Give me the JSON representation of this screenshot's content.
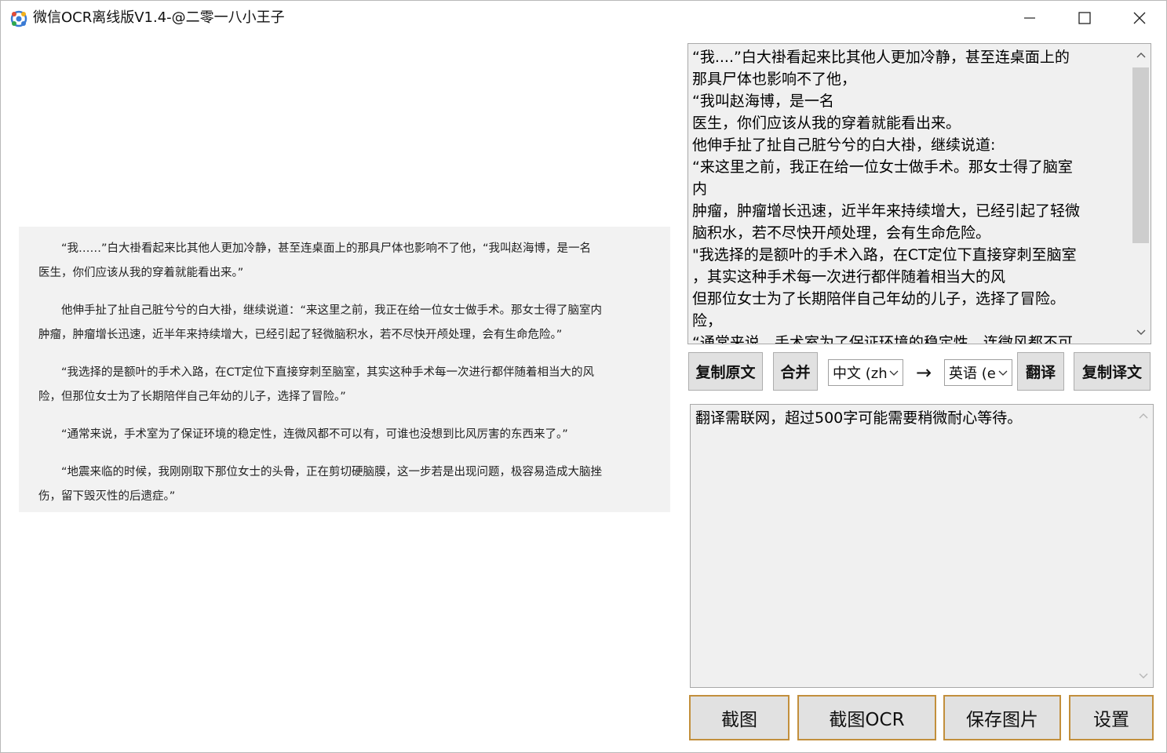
{
  "window": {
    "title": "微信OCR离线版V1.4-@二零一八小王子"
  },
  "capture": {
    "paragraphs": [
      {
        "lines": [
          "　　“我……”白大褂看起来比其他人更加冷静，甚至连桌面上的那具尸体也影响不了他，“我叫赵海博，是一名",
          "医生，你们应该从我的穿着就能看出来。”"
        ]
      },
      {
        "lines": [
          "　　他伸手扯了扯自己脏兮兮的白大褂，继续说道：“来这里之前，我正在给一位女士做手术。那女士得了脑室内",
          "肿瘤，肿瘤增长迅速，近半年来持续增大，已经引起了轻微脑积水，若不尽快开颅处理，会有生命危险。”"
        ]
      },
      {
        "lines": [
          "　　“我选择的是额叶的手术入路，在CT定位下直接穿刺至脑室，其实这种手术每一次进行都伴随着相当大的风",
          "险，但那位女士为了长期陪伴自己年幼的儿子，选择了冒险。”"
        ]
      },
      {
        "lines": [
          "　　“通常来说，手术室为了保证环境的稳定性，连微风都不可以有，可谁也没想到比风厉害的东西来了。”"
        ]
      },
      {
        "lines": [
          "　　“地震来临的时候，我刚刚取下那位女士的头骨，正在剪切硬脑膜，这一步若是出现问题，极容易造成大脑挫",
          "伤，留下毁灭性的后遗症。”"
        ]
      }
    ]
  },
  "source_text": {
    "lines": [
      " “我....”白大褂看起来比其他人更加冷静，甚至连桌面上的",
      "那具尸体也影响不了他，",
      " “我叫赵海博，是一名",
      "医生，你们应该从我的穿着就能看出来。",
      "他伸手扯了扯自己脏兮兮的白大褂，继续说道:",
      " “来这里之前，我正在给一位女士做手术。那女士得了脑室",
      "内",
      "肿瘤，肿瘤增长迅速，近半年来持续增大，已经引起了轻微",
      "脑积水，若不尽快开颅处理，会有生命危险。",
      "\"我选择的是额叶的手术入路，在CT定位下直接穿刺至脑室",
      "，其实这种手术每一次进行都伴随着相当大的风",
      "但那位女士为了长期陪伴自己年幼的儿子，选择了冒险。",
      "险，",
      " “通常来说，手术室为了保证环境的稳定性，连微风都不可"
    ]
  },
  "toolbar": {
    "copy_source_label": "复制原文",
    "merge_label": "合并",
    "source_lang": "中文 (zh",
    "arrow": "→",
    "target_lang": "英语 (e",
    "translate_label": "翻译",
    "copy_translation_label": "复制译文"
  },
  "translation": {
    "text": "翻译需联网，超过500字可能需要稍微耐心等待。"
  },
  "bottom_buttons": {
    "screenshot_label": "截图",
    "screenshot_ocr_label": "截图OCR",
    "save_image_label": "保存图片",
    "settings_label": "设置"
  },
  "icons": {
    "app": "ocr-lens-icon",
    "minimize": "minimize-icon",
    "maximize": "maximize-icon",
    "close": "close-icon",
    "scroll_up": "chevron-up-icon",
    "scroll_down": "chevron-down-icon",
    "dropdown": "chevron-down-icon"
  },
  "colors": {
    "bottom_button_border": "#c28f3c",
    "text_box_bg": "#f0f0f0",
    "capture_bg": "#f2f2f2"
  }
}
